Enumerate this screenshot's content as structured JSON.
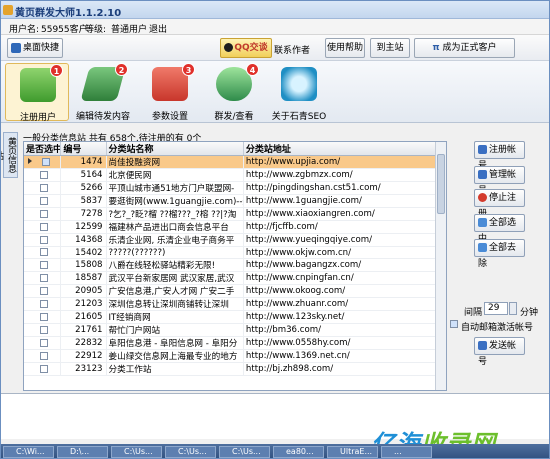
{
  "window": {
    "title": "黄页群发大师1.1.2.10"
  },
  "user": {
    "label_user": "用户名:",
    "username": "55955客户",
    "label_level": "等级:",
    "level": "普通用户",
    "logout": "退出"
  },
  "toolbar": {
    "desktop_shortcut": "桌面快捷",
    "qq_label": "QQ交谈",
    "contact_author": "联系作者",
    "help": "使用帮助",
    "home": "到主站",
    "become_official": "成为正式客户"
  },
  "nav": [
    {
      "label": "注册用户",
      "badge": "1",
      "color": "#3f9b2d"
    },
    {
      "label": "编辑待发内容",
      "badge": "2",
      "color": "#2f7f3a"
    },
    {
      "label": "参数设置",
      "badge": "3",
      "color": "#c8362b"
    },
    {
      "label": "群发/查看",
      "badge": "4",
      "color": "#2e8b4a"
    },
    {
      "label": "关于石青SEO",
      "badge": "",
      "color": "#1f8fc4"
    }
  ],
  "side_tab": "黄页信息站",
  "summary": "一般分类信息站 共有 658个,待注册的有 0个",
  "table": {
    "headers": [
      "是否选中",
      "编号",
      "分类站名称",
      "分类站地址"
    ],
    "rows": [
      {
        "checked": true,
        "id": "1474",
        "name": "尚佳投融资网",
        "url": "http://www.upjia.com/",
        "selected": true
      },
      {
        "checked": false,
        "id": "5164",
        "name": "北京便民网",
        "url": "http://www.zgbmzx.com/"
      },
      {
        "checked": false,
        "id": "5266",
        "name": "平顶山城市通51地方门户联盟网-",
        "url": "http://pingdingshan.cst51.com/"
      },
      {
        "checked": false,
        "id": "5837",
        "name": "要逛街网(www.1guangjie.com)--逛",
        "url": "http://www.1guangjie.com/"
      },
      {
        "checked": false,
        "id": "7278",
        "name": "?乞?_?眨?榴 ??榴???_?榕 ??|?淘",
        "url": "http://www.xiaoxiangren.com/"
      },
      {
        "checked": false,
        "id": "12599",
        "name": "福建林产品进出口商会信息平台",
        "url": "http://fjcffb.com/"
      },
      {
        "checked": false,
        "id": "14368",
        "name": "乐清企业网, 乐清企业电子商务平",
        "url": "http://www.yueqingqiye.com/"
      },
      {
        "checked": false,
        "id": "15402",
        "name": "?????(??????)",
        "url": "http://www.okjw.com.cn/"
      },
      {
        "checked": false,
        "id": "15808",
        "name": "八爵在线轻松驿站精彩无限!",
        "url": "http://www.bagangzx.com/"
      },
      {
        "checked": false,
        "id": "18587",
        "name": "武汉平台新家居网 武汉家居,武汉",
        "url": "http://www.cnpingfan.cn/"
      },
      {
        "checked": false,
        "id": "20905",
        "name": "广安信息港,广安人才网 广安二手",
        "url": "http://www.okoog.com/"
      },
      {
        "checked": false,
        "id": "21203",
        "name": "深圳信息转让深圳商铺转让深圳",
        "url": "http://www.zhuanr.com/"
      },
      {
        "checked": false,
        "id": "21605",
        "name": "IT经销商网",
        "url": "http://www.123sky.net/"
      },
      {
        "checked": false,
        "id": "21761",
        "name": "帮忙门户网站",
        "url": "http://bm36.com/"
      },
      {
        "checked": false,
        "id": "22832",
        "name": "阜阳信息港 - 阜阳信息网 - 阜阳分",
        "url": "http://www.0558hy.com/"
      },
      {
        "checked": false,
        "id": "22912",
        "name": "姜山绿交信息网上海最专业的地方",
        "url": "http://www.1369.net.cn/"
      },
      {
        "checked": false,
        "id": "23123",
        "name": "分类工作站",
        "url": "http://bj.zh898.com/"
      }
    ]
  },
  "actions": {
    "register_account": "注册帐号",
    "manage_account": "管理帐号",
    "stop_register": "停止注册",
    "select_all": "全部选中",
    "clear_all": "全部去除",
    "interval_label": "间隔",
    "interval_value": "29",
    "minute": "分钟",
    "auto_email": "自动邮箱激活帐号",
    "send_account": "发送帐号"
  },
  "taskbar": [
    "C:\\Wi...",
    "D:\\...",
    "C:\\Us...",
    "C:\\Us...",
    "C:\\Us...",
    "ea80...",
    "UltraE...",
    "..."
  ],
  "watermark": {
    "a": "亿海",
    "b": "收录网"
  },
  "colors": {
    "accent": "#1a3d7a",
    "selected_row": "#f9c98a"
  }
}
